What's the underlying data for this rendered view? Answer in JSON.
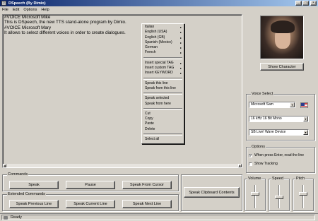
{
  "window": {
    "title": "DSpeech (By Dimio)"
  },
  "menubar": {
    "items": [
      "File",
      "Edit",
      "Options",
      "Help"
    ]
  },
  "editor": {
    "lines": [
      "#VOICE Microsoft Mike",
      "This is DSpeech, the new TTS stand-alone program by Dimio.",
      "#VOICE Microsoft Mary",
      "It allows to select different voices in order to create dialogues."
    ]
  },
  "context_menu": {
    "groups": [
      [
        {
          "label": "Italian",
          "submenu": true
        },
        {
          "label": "English (USA)",
          "submenu": true
        },
        {
          "label": "English (GB)",
          "submenu": true
        },
        {
          "label": "Spanish (Mexico)",
          "submenu": true
        },
        {
          "label": "German",
          "submenu": true
        },
        {
          "label": "French",
          "submenu": true
        }
      ],
      [
        {
          "label": "Insert special TAG",
          "submenu": true
        },
        {
          "label": "Insert custom TAG",
          "submenu": true
        },
        {
          "label": "Insert KEYWORD",
          "submenu": true
        }
      ],
      [
        {
          "label": "Speak this line",
          "submenu": false
        },
        {
          "label": "Speak from this line",
          "submenu": false
        }
      ],
      [
        {
          "label": "Speak selected",
          "submenu": false
        },
        {
          "label": "Speak from here",
          "submenu": false
        }
      ],
      [
        {
          "label": "Cut",
          "submenu": false
        },
        {
          "label": "Copy",
          "submenu": false
        },
        {
          "label": "Paste",
          "submenu": false
        },
        {
          "label": "Delete",
          "submenu": false
        }
      ],
      [
        {
          "label": "Select all",
          "submenu": false
        }
      ]
    ]
  },
  "character": {
    "button_label": "Show Character"
  },
  "voice_select": {
    "group_label": "Voice Select",
    "voice": "Microsoft Sam",
    "format": "16 kHz 16 Bit Mono",
    "device": "SB Live! Wave Device"
  },
  "options": {
    "group_label": "Options",
    "read_line_label": "When press Enter, read the line",
    "read_line_checked": true,
    "tracking_label": "Show Tracking",
    "tracking_checked": false
  },
  "commands": {
    "group_label": "Commands",
    "speak": "Speak",
    "pause": "Pause",
    "speak_from_cursor": "Speak From Cursor"
  },
  "extended": {
    "group_label": "Extended Commands",
    "speak_previous": "Speak Previous Line",
    "speak_current": "Speak Current Line",
    "speak_next": "Speak Next Line",
    "speak_clipboard": "Speak Clipboard Contents"
  },
  "sliders": {
    "volume_label": "Volume",
    "speed_label": "Speed",
    "pitch_label": "Pitch"
  },
  "status": {
    "text": "Ready"
  },
  "colors": {
    "title_start": "#0a246a",
    "title_end": "#a6caf0",
    "face": "#d4d0c8"
  }
}
